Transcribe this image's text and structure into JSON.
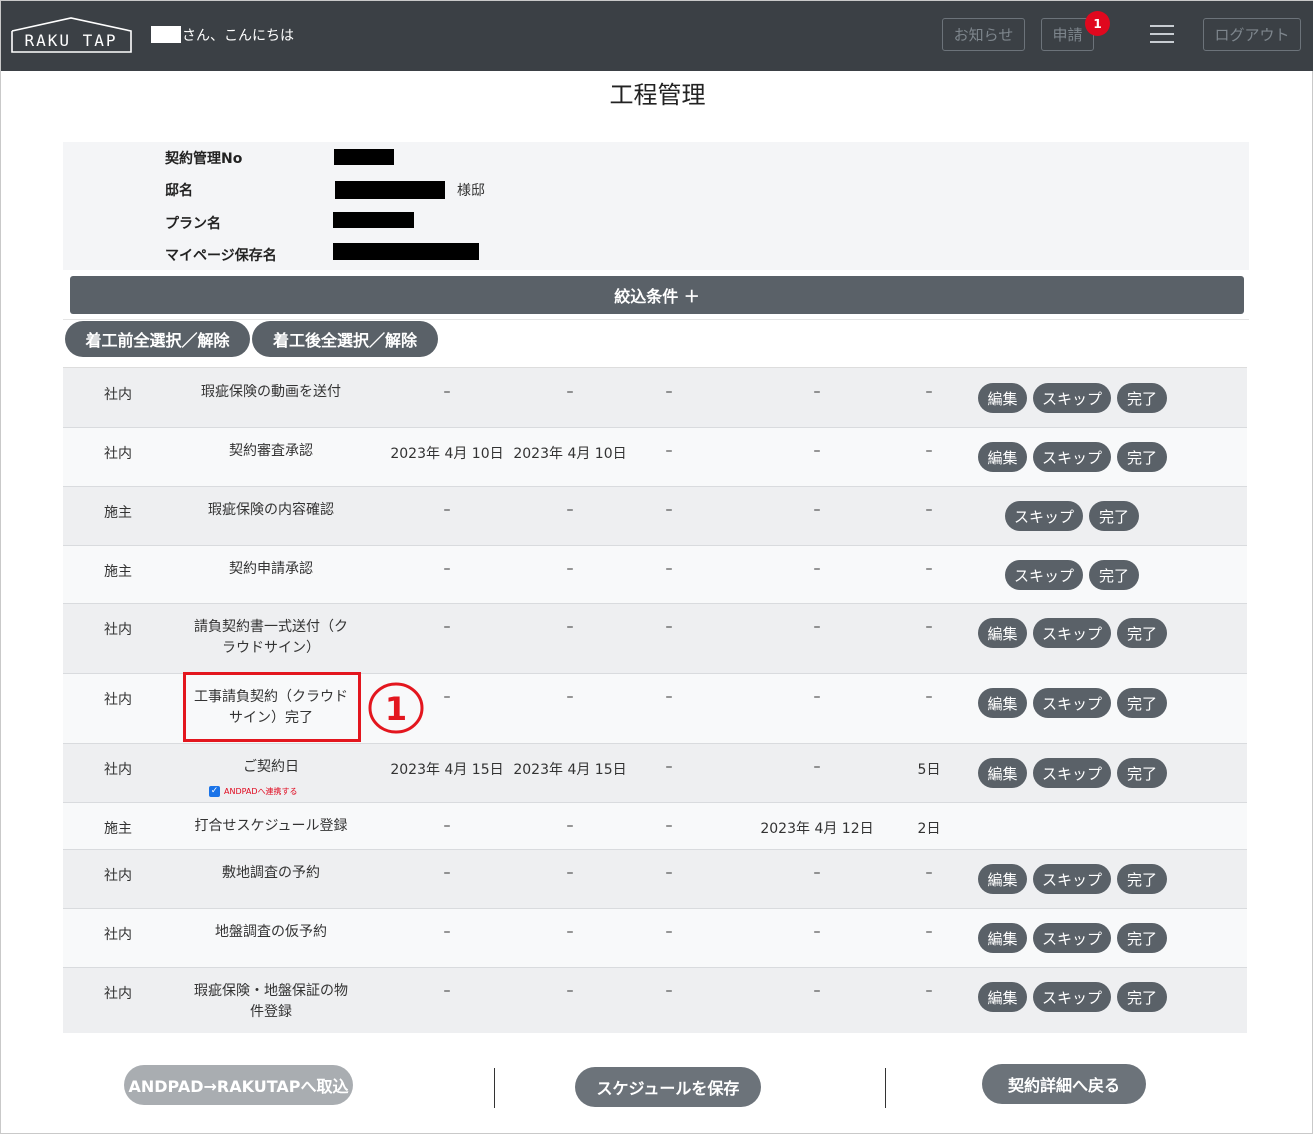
{
  "header": {
    "logo_text": "RAKU TAP",
    "greeting": "さん、こんにちは",
    "notice_label": "お知らせ",
    "apply_label": "申請",
    "apply_badge": "1",
    "logout_label": "ログアウト"
  },
  "page": {
    "title": "工程管理"
  },
  "info": {
    "contract_no_label": "契約管理No",
    "house_name_label": "邸名",
    "house_suffix": "様邸",
    "plan_label": "プラン名",
    "mypage_label": "マイページ保存名"
  },
  "filter": {
    "label": "絞込条件 ＋"
  },
  "select_buttons": {
    "before": "着工前全選択／解除",
    "after": "着工後全選択／解除"
  },
  "actions": {
    "edit": "編集",
    "skip": "スキップ",
    "done": "完了"
  },
  "rows": [
    {
      "category": "社内",
      "name": "瑕疵保険の動画を送付",
      "d1": "–",
      "d2": "–",
      "d3": "–",
      "d4": "–",
      "d5": "–"
    },
    {
      "category": "社内",
      "name": "契約審査承認",
      "d1": "2023年 4月 10日",
      "d2": "2023年 4月 10日",
      "d3": "–",
      "d4": "–",
      "d5": "–"
    },
    {
      "category": "施主",
      "name": "瑕疵保険の内容確認",
      "d1": "–",
      "d2": "–",
      "d3": "–",
      "d4": "–",
      "d5": "–"
    },
    {
      "category": "施主",
      "name": "契約申請承認",
      "d1": "–",
      "d2": "–",
      "d3": "–",
      "d4": "–",
      "d5": "–"
    },
    {
      "category": "社内",
      "name": "請負契約書一式送付（クラウドサイン）",
      "d1": "–",
      "d2": "–",
      "d3": "–",
      "d4": "–",
      "d5": "–"
    },
    {
      "category": "社内",
      "name": "工事請負契約（クラウドサイン）完了",
      "d1": "–",
      "d2": "–",
      "d3": "–",
      "d4": "–",
      "d5": "–"
    },
    {
      "category": "社内",
      "name": "ご契約日",
      "d1": "2023年 4月 15日",
      "d2": "2023年 4月 15日",
      "d3": "–",
      "d4": "–",
      "d5": "5日",
      "andpad": "ANDPADへ連携する"
    },
    {
      "category": "施主",
      "name": "打合せスケジュール登録",
      "d1": "–",
      "d2": "–",
      "d3": "–",
      "d4": "2023年 4月 12日",
      "d5": "2日"
    },
    {
      "category": "社内",
      "name": "敷地調査の予約",
      "d1": "–",
      "d2": "–",
      "d3": "–",
      "d4": "–",
      "d5": "–"
    },
    {
      "category": "社内",
      "name": "地盤調査の仮予約",
      "d1": "–",
      "d2": "–",
      "d3": "–",
      "d4": "–",
      "d5": "–"
    },
    {
      "category": "社内",
      "name": "瑕疵保険・地盤保証の物件登録",
      "d1": "–",
      "d2": "–",
      "d3": "–",
      "d4": "–",
      "d5": "–"
    }
  ],
  "annotation": {
    "marker": "①"
  },
  "footer": {
    "import_label": "ANDPAD→RAKUTAPへ取込",
    "save_label": "スケジュールを保存",
    "back_label": "契約詳細へ戻る"
  },
  "colors": {
    "header_bg": "#3b4045",
    "button_bg": "#5a6168",
    "badge": "#e0081e",
    "highlight": "#e3161e"
  }
}
